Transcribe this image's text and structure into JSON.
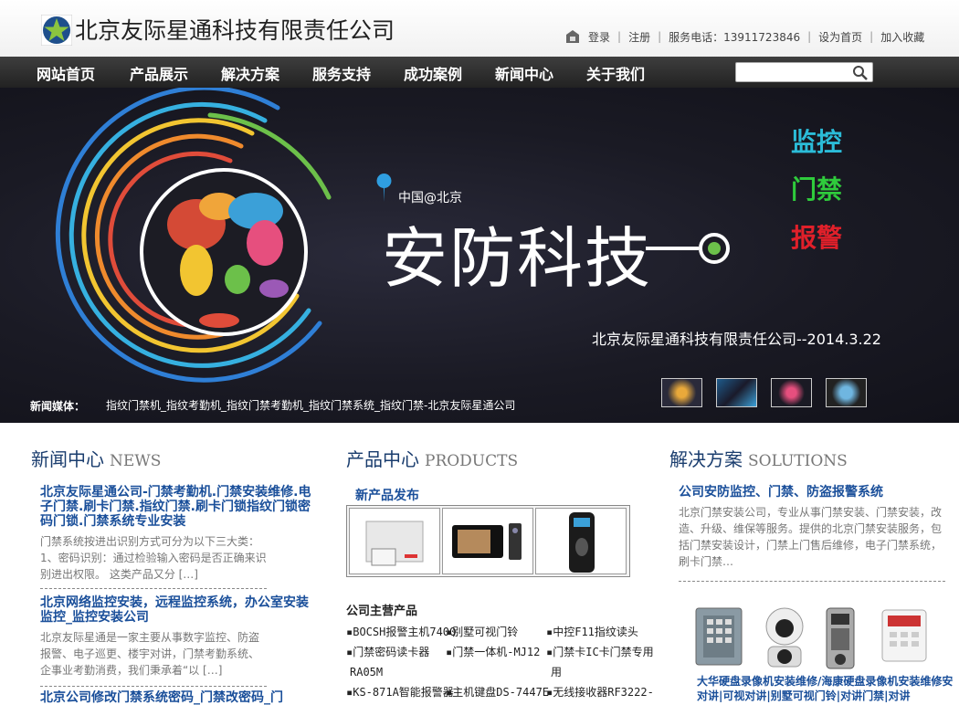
{
  "header": {
    "company": "北京友际星通科技有限责任公司",
    "links": [
      "登录",
      "注册",
      "服务电话：13911723846",
      "设为首页",
      "加入收藏"
    ]
  },
  "nav": {
    "items": [
      "网站首页",
      "产品展示",
      "解决方案",
      "服务支持",
      "成功案例",
      "新闻中心",
      "关于我们"
    ],
    "search_placeholder": ""
  },
  "banner": {
    "location": "中国@北京",
    "title": "安防科技",
    "side_words": [
      "监控",
      "门禁",
      "报警"
    ],
    "caption": "北京友际星通科技有限责任公司--2014.3.22",
    "media_label": "新闻媒体：",
    "media_text": "指纹门禁机_指纹考勤机_指纹门禁考勤机_指纹门禁系统_指纹门禁-北京友际星通公司"
  },
  "news": {
    "title": "新闻中心",
    "title_en": "NEWS",
    "items": [
      {
        "headline": "北京友际星通公司-门禁考勤机.门禁安装维修.电子门禁.刷卡门禁.指纹门禁.刷卡门锁指纹门锁密码门锁.门禁系统专业安装",
        "body": "门禁系统按进出识别方式可分为以下三大类：1、密码识别：通过检验输入密码是否正确来识别进出权限。 这类产品又分 […]"
      },
      {
        "headline": "北京网络监控安装，远程监控系统，办公室安装监控_监控安装公司",
        "body": "北京友际星通是一家主要从事数字监控、防盗报警、电子巡更、楼宇对讲，门禁考勤系统、企事业考勤消费，我们秉承着“以 […]"
      },
      {
        "headline": "北京公司修改门禁系统密码_门禁改密码_门"
      }
    ]
  },
  "products": {
    "title": "产品中心",
    "title_en": "PRODUCTS",
    "new_label": "新产品发布",
    "main_label": "公司主营产品",
    "list": [
      "BOCSH报警主机7400",
      "别墅可视门铃",
      "中控F11指纹读头",
      "门禁密码读卡器",
      "门禁一体机-MJ12",
      "门禁卡IC卡门禁专用",
      "RA05M",
      "KS-871A智能报警器",
      "主机键盘DS-7447E",
      "无线接收器RF3222-"
    ]
  },
  "solutions": {
    "title": "解决方案",
    "title_en": "SOLUTIONS",
    "headline": "公司安防监控、门禁、防盗报警系统",
    "body": "北京门禁安装公司，专业从事门禁安装、门禁安装，改造、升级、维保等服务。提供的北京门禁安装服务，包括门禁安装设计，门禁上门售后维修，电子门禁系统，刷卡门禁…",
    "caption": "大华硬盘录像机安装维修/海康硬盘录像机安装维修安对讲|可视对讲|别墅可视门铃|对讲门禁|对讲"
  }
}
